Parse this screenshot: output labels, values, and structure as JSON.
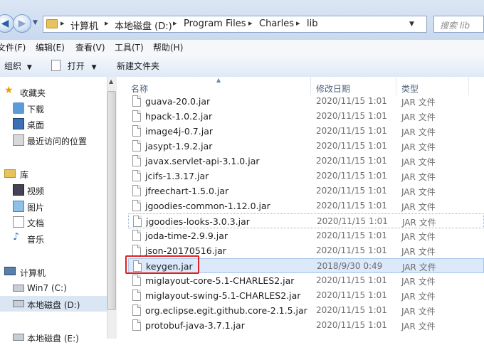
{
  "address": {
    "crumbs": [
      "计算机",
      "本地磁盘 (D:)",
      "Program Files",
      "Charles",
      "lib"
    ],
    "search_placeholder": "搜索 lib"
  },
  "menu": [
    "文件(F)",
    "编辑(E)",
    "查看(V)",
    "工具(T)",
    "帮助(H)"
  ],
  "toolbar": {
    "organize": "组织",
    "open": "打开",
    "new_folder": "新建文件夹"
  },
  "nav": {
    "favorites": "收藏夹",
    "downloads": "下载",
    "desktop": "桌面",
    "recent": "最近访问的位置",
    "libraries": "库",
    "videos": "视频",
    "pictures": "图片",
    "documents": "文档",
    "music": "音乐",
    "computer": "计算机",
    "win7": "Win7 (C:)",
    "drive_d": "本地磁盘 (D:)",
    "drive_e": "本地磁盘 (E:)"
  },
  "columns": {
    "name": "名称",
    "date": "修改日期",
    "type": "类型"
  },
  "files": [
    {
      "name": "guava-20.0.jar",
      "date": "2020/11/15 1:01",
      "type": "JAR 文件"
    },
    {
      "name": "hpack-1.0.2.jar",
      "date": "2020/11/15 1:01",
      "type": "JAR 文件"
    },
    {
      "name": "image4j-0.7.jar",
      "date": "2020/11/15 1:01",
      "type": "JAR 文件"
    },
    {
      "name": "jasypt-1.9.2.jar",
      "date": "2020/11/15 1:01",
      "type": "JAR 文件"
    },
    {
      "name": "javax.servlet-api-3.1.0.jar",
      "date": "2020/11/15 1:01",
      "type": "JAR 文件"
    },
    {
      "name": "jcifs-1.3.17.jar",
      "date": "2020/11/15 1:01",
      "type": "JAR 文件"
    },
    {
      "name": "jfreechart-1.5.0.jar",
      "date": "2020/11/15 1:01",
      "type": "JAR 文件"
    },
    {
      "name": "jgoodies-common-1.12.0.jar",
      "date": "2020/11/15 1:01",
      "type": "JAR 文件"
    },
    {
      "name": "jgoodies-looks-3.0.3.jar",
      "date": "2020/11/15 1:01",
      "type": "JAR 文件"
    },
    {
      "name": "joda-time-2.9.9.jar",
      "date": "2020/11/15 1:01",
      "type": "JAR 文件"
    },
    {
      "name": "json-20170516.jar",
      "date": "2020/11/15 1:01",
      "type": "JAR 文件"
    },
    {
      "name": "keygen.jar",
      "date": "2018/9/30 0:49",
      "type": "JAR 文件"
    },
    {
      "name": "miglayout-core-5.1-CHARLES2.jar",
      "date": "2020/11/15 1:01",
      "type": "JAR 文件"
    },
    {
      "name": "miglayout-swing-5.1-CHARLES2.jar",
      "date": "2020/11/15 1:01",
      "type": "JAR 文件"
    },
    {
      "name": "org.eclipse.egit.github.core-2.1.5.jar",
      "date": "2020/11/15 1:01",
      "type": "JAR 文件"
    },
    {
      "name": "protobuf-java-3.7.1.jar",
      "date": "2020/11/15 1:01",
      "type": "JAR 文件"
    }
  ]
}
